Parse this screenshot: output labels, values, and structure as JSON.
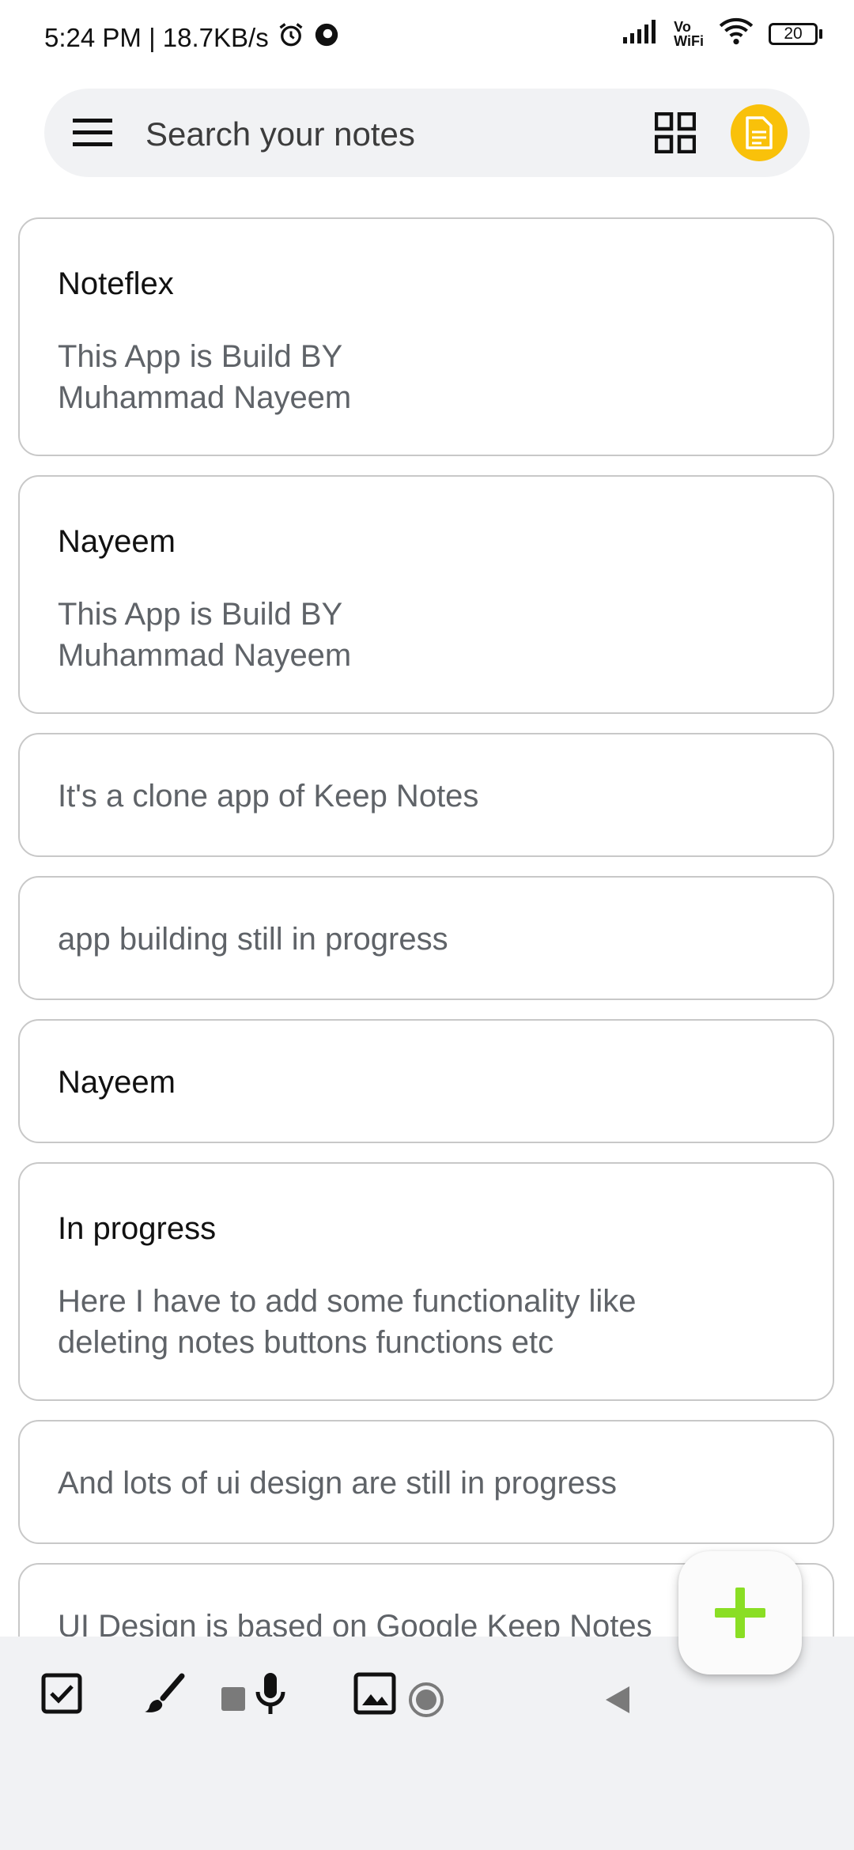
{
  "status_bar": {
    "time_speed": "5:24 PM | 18.7KB/s",
    "network_label_top": "Vo",
    "network_label_bottom": "WiFi",
    "battery": "20",
    "icons": [
      "alarm-icon",
      "data-saver-icon",
      "signal-icon",
      "wifi-icon",
      "battery-icon"
    ]
  },
  "search": {
    "placeholder": "Search your notes"
  },
  "notes": [
    {
      "title": "Noteflex",
      "body": "This App is Build BY\nMuhammad Nayeem"
    },
    {
      "title": "Nayeem",
      "body": "This App is Build BY\nMuhammad Nayeem"
    },
    {
      "title": "",
      "body": "It's a clone app of Keep Notes"
    },
    {
      "title": "",
      "body": "app building still in progress"
    },
    {
      "title": "Nayeem",
      "body": ""
    },
    {
      "title": "In progress",
      "body": "Here I have to add some functionality like\ndeleting notes buttons functions etc"
    },
    {
      "title": "",
      "body": "And lots of ui design are still in progress"
    },
    {
      "title": "",
      "body": "UI Design is based on Google Keep Notes"
    }
  ],
  "toolbar": {
    "icons": [
      "checkbox-icon",
      "brush-icon",
      "mic-icon",
      "image-icon"
    ]
  },
  "fab": {
    "icon": "plus-icon",
    "color": "#8ade24"
  },
  "accent": {
    "avatar": "#f9c10a"
  }
}
